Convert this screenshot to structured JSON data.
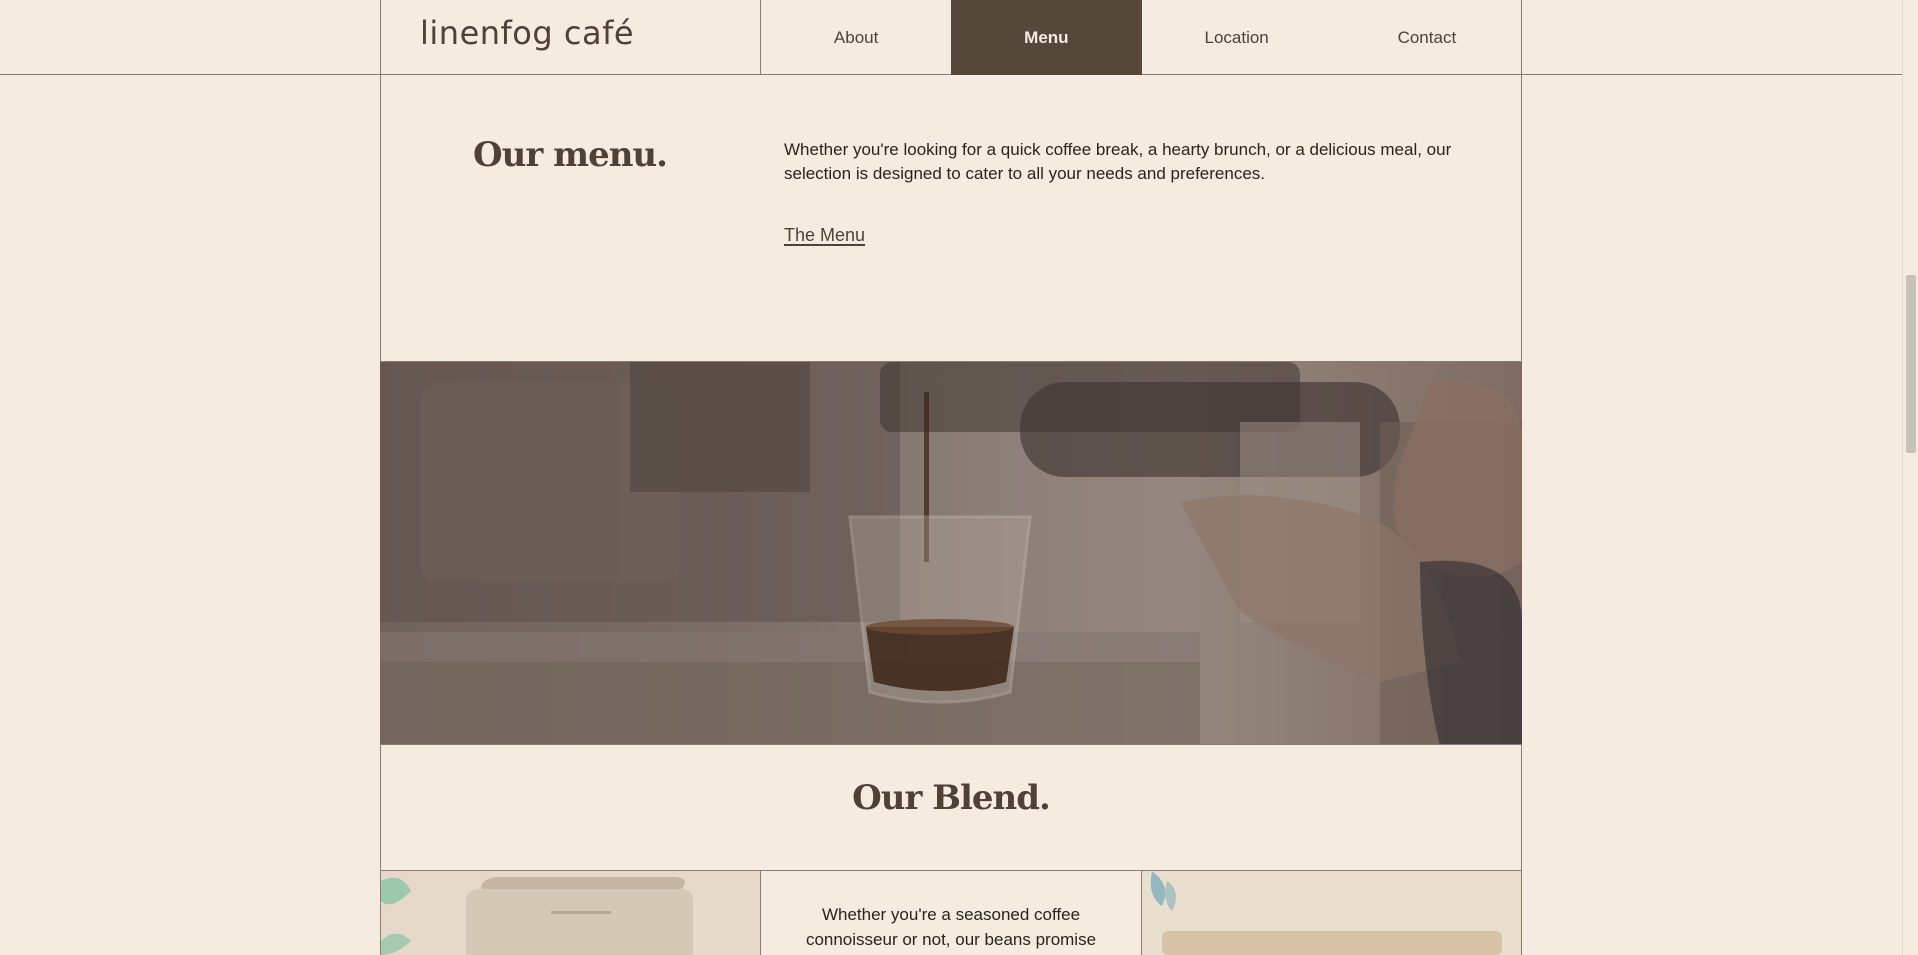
{
  "header": {
    "brand": "linenfog café",
    "nav": [
      {
        "label": "About"
      },
      {
        "label": "Menu"
      },
      {
        "label": "Location"
      },
      {
        "label": "Contact"
      }
    ],
    "active_nav": "Menu"
  },
  "menu_section": {
    "title": "Our menu.",
    "description": "Whether you're looking for a quick coffee break, a hearty brunch, or a delicious meal, our selection is designed to cater to all your needs and preferences.",
    "link_label": "The Menu"
  },
  "blend_section": {
    "title": "Our Blend.",
    "text": "Whether you're a seasoned coffee connoisseur or not, our beans promise"
  },
  "colors": {
    "background": "#f6ebe1",
    "text": "#4e4236",
    "active_nav": "#55473a"
  },
  "icons": [
    "espresso-photo",
    "coffee-bag-photo"
  ]
}
